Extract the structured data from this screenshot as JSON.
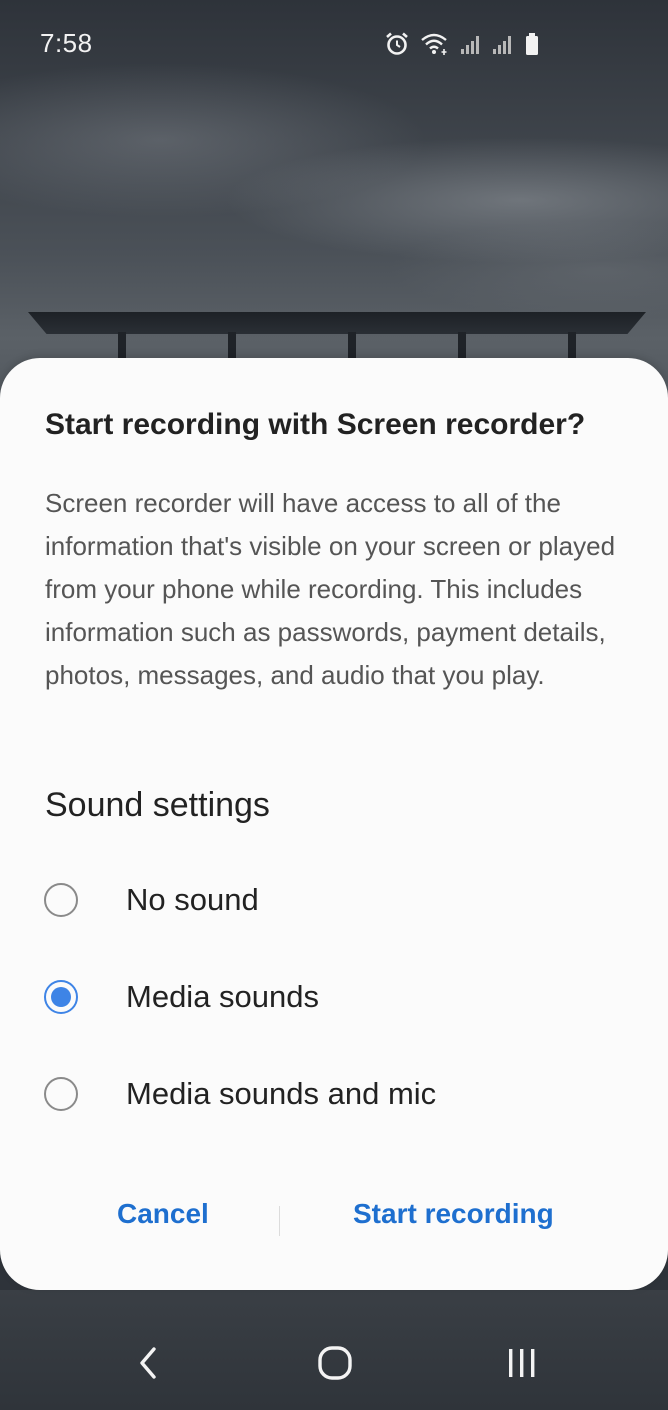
{
  "status_bar": {
    "time": "7:58",
    "icons": [
      "alarm-icon",
      "wifi-icon",
      "signal-icon",
      "signal-icon",
      "battery-icon"
    ]
  },
  "dialog": {
    "title": "Start recording with Screen recorder?",
    "body": "Screen recorder will have access to all of the information that's visible on your screen or played from your phone while recording. This includes information such as passwords, payment details, photos, messages, and audio that you play.",
    "sound_heading": "Sound settings",
    "options": [
      {
        "label": "No sound",
        "selected": false
      },
      {
        "label": "Media sounds",
        "selected": true
      },
      {
        "label": "Media sounds and mic",
        "selected": false
      }
    ],
    "cancel_label": "Cancel",
    "start_label": "Start recording"
  },
  "nav_bar": {
    "icons": [
      "back-icon",
      "home-icon",
      "recents-icon"
    ]
  },
  "colors": {
    "accent": "#3e84e6",
    "button_text": "#1e6fcf",
    "dialog_bg": "#fbfbfb"
  }
}
